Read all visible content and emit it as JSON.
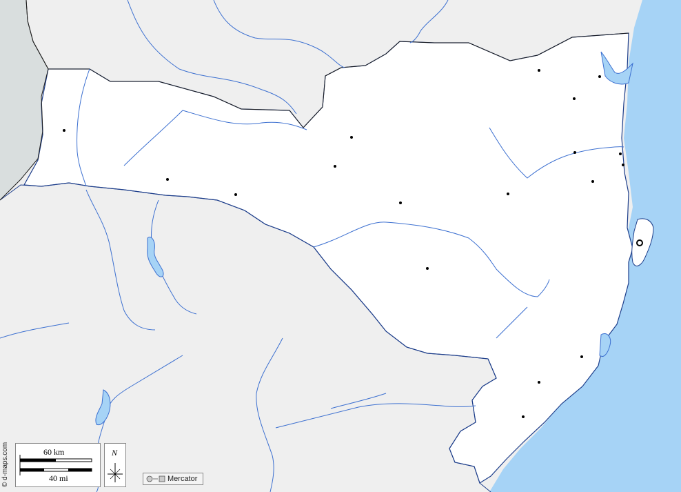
{
  "map": {
    "projection_label": "Mercator",
    "credit": "© d-maps.com",
    "compass_letter": "N",
    "scale": {
      "metric_label": "60 km",
      "imperial_label": "40 mi"
    }
  },
  "colors": {
    "ocean": "#a6d3f6",
    "highlight_region": "#ffffff",
    "neighbor_land": "#efefef",
    "foreign_land": "#d9dede",
    "river": "#3b6fd0",
    "border": "#1c1c1c",
    "city": "#000000"
  },
  "icons": [
    "city-dot-icon",
    "capital-icon",
    "compass-rose-icon",
    "projection-icon"
  ]
}
